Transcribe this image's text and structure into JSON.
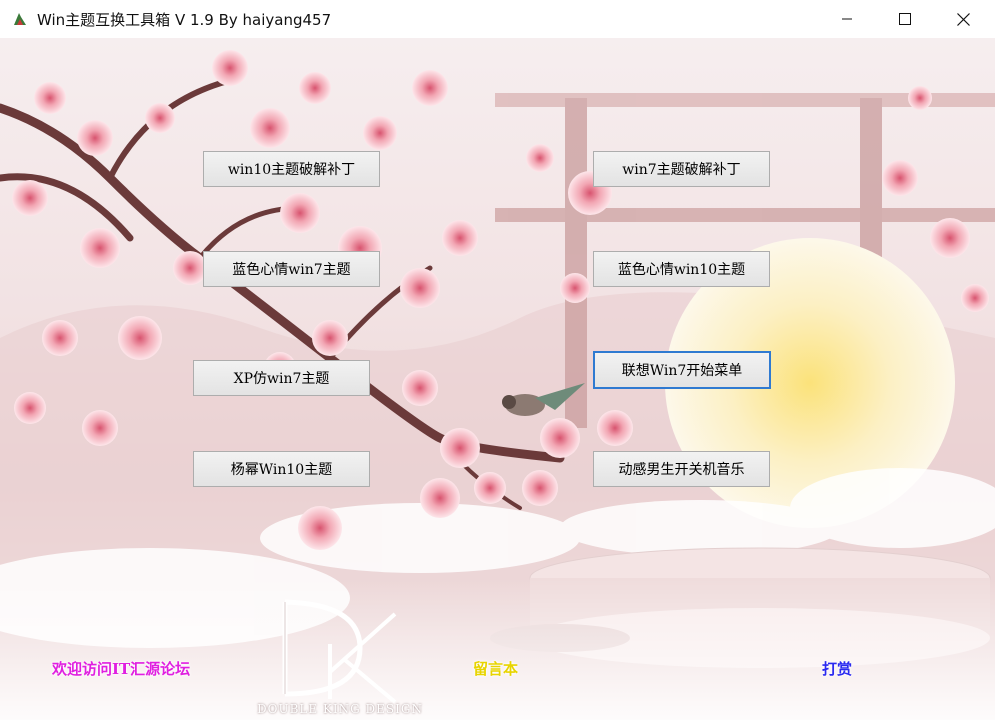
{
  "window": {
    "title": "Win主题互换工具箱 V 1.9  By haiyang457",
    "controls": {
      "minimize": "minimize-icon",
      "maximize": "maximize-icon",
      "close": "close-icon"
    }
  },
  "buttons": {
    "win10_patch": "win10主题破解补丁",
    "win7_patch": "win7主题破解补丁",
    "blue_win7": "蓝色心情win7主题",
    "blue_win10": "蓝色心情win10主题",
    "xp_win7": "XP仿win7主题",
    "lenovo_menu": "联想Win7开始菜单",
    "yangmi_win10": "杨幂Win10主题",
    "boot_music": "动感男生开关机音乐"
  },
  "links": {
    "visit_forum": "欢迎访问IT汇源论坛",
    "guestbook": "留言本",
    "donate": "打赏"
  },
  "logo": {
    "monogram": "DK",
    "caption": "DOUBLE KING DESIGN"
  },
  "colors": {
    "link_visit": "#e020e0",
    "link_guestbook": "#f5e400",
    "link_donate": "#2a2af0",
    "focus_border": "#2f7ad1"
  }
}
